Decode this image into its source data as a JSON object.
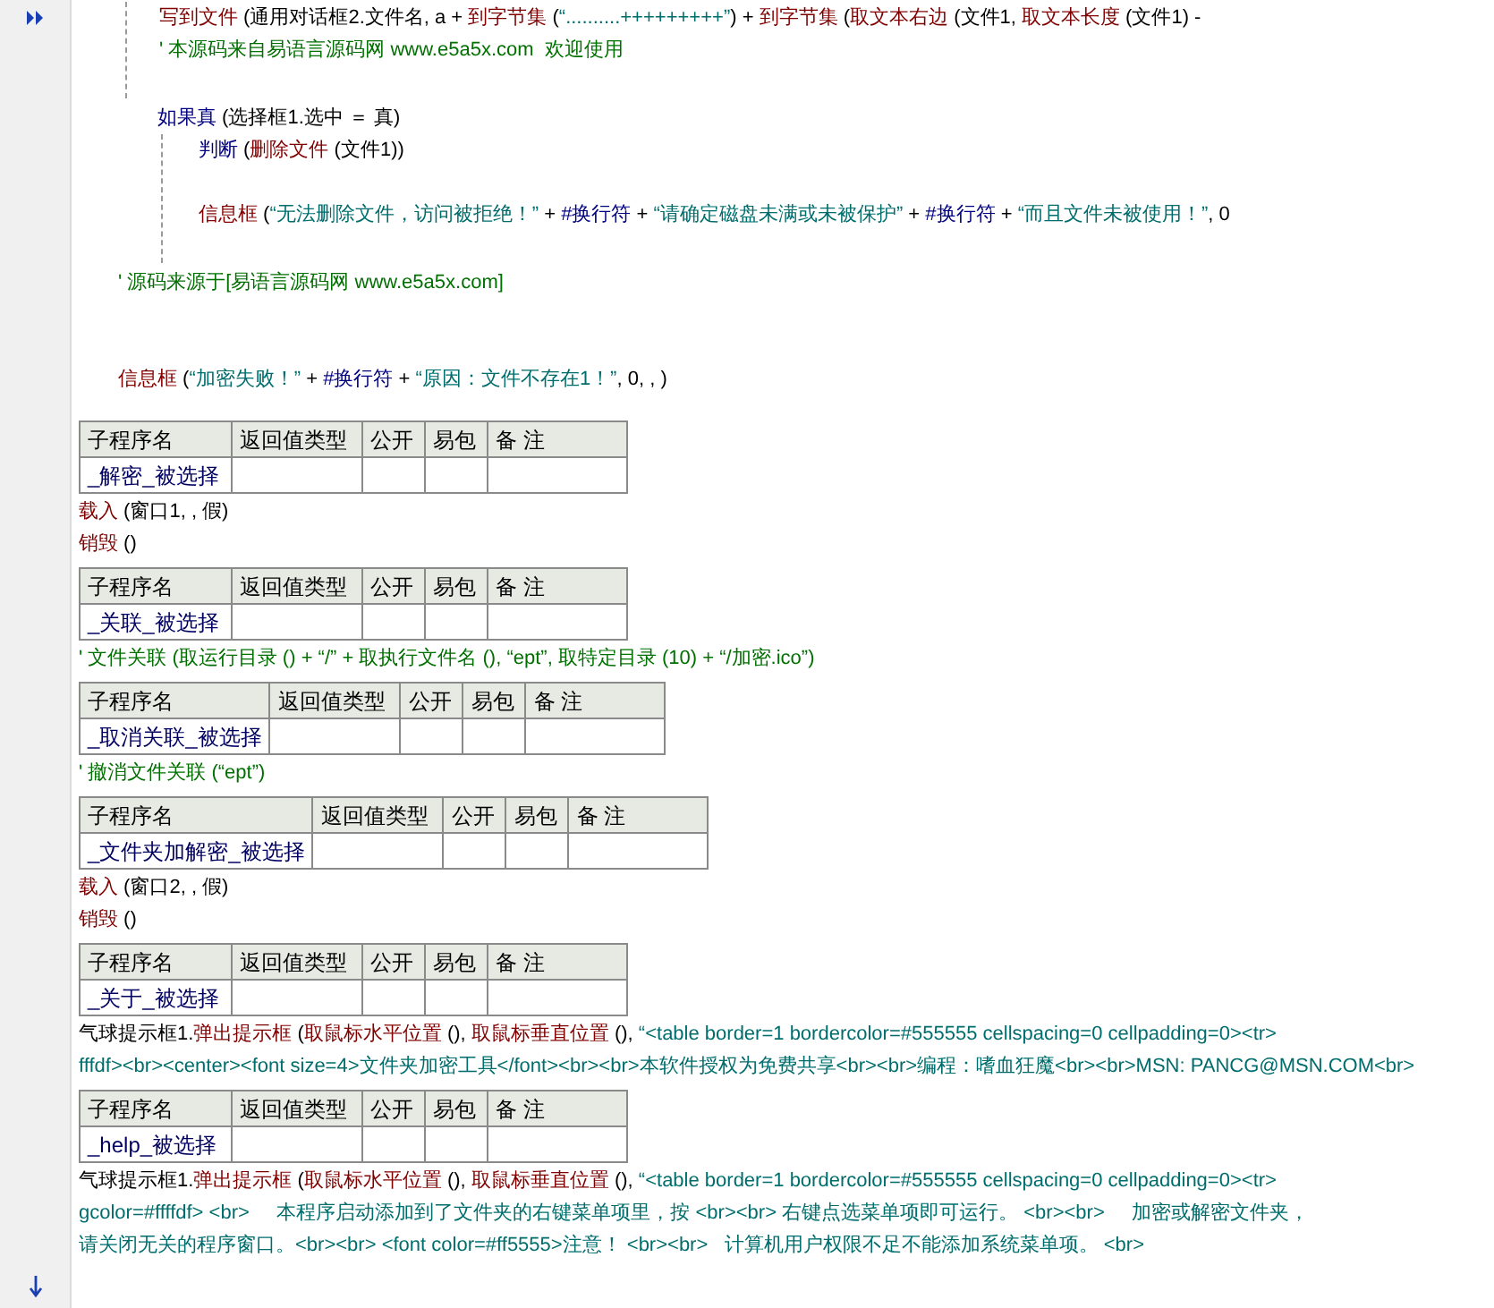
{
  "continued_lines": [
    {
      "segments": [
        {
          "kind": "cmd",
          "text": "写到文件"
        },
        {
          "kind": "plain",
          "text": " (通用对话框2.文件名, a + "
        },
        {
          "kind": "cmd",
          "text": "到字节集"
        },
        {
          "kind": "plain",
          "text": " ("
        },
        {
          "kind": "string",
          "text": "“..........+++++++++”"
        },
        {
          "kind": "plain",
          "text": ") + "
        },
        {
          "kind": "cmd",
          "text": "到字节集"
        },
        {
          "kind": "plain",
          "text": " ("
        },
        {
          "kind": "cmd",
          "text": "取文本右边"
        },
        {
          "kind": "plain",
          "text": " (文件1, "
        },
        {
          "kind": "cmd",
          "text": "取文本长度"
        },
        {
          "kind": "plain",
          "text": " (文件1) -"
        }
      ]
    },
    {
      "segments": [
        {
          "kind": "comment",
          "text": "' 本源码来自易语言源码网 www.e5a5x.com  欢迎使用"
        }
      ]
    }
  ],
  "branch": {
    "header": {
      "segments": [
        {
          "kind": "flow",
          "text": "如果真"
        },
        {
          "kind": "plain",
          "text": " (选择框1.选中 ＝ 真)"
        }
      ]
    },
    "children": [
      {
        "segments": [
          {
            "kind": "flow",
            "text": "判断"
          },
          {
            "kind": "plain",
            "text": " ("
          },
          {
            "kind": "cmd",
            "text": "删除文件"
          },
          {
            "kind": "plain",
            "text": " (文件1))"
          }
        ]
      },
      {
        "segments": [
          {
            "kind": "cmd",
            "text": "信息框"
          },
          {
            "kind": "plain",
            "text": " ("
          },
          {
            "kind": "string",
            "text": "“无法删除文件，访问被拒绝！”"
          },
          {
            "kind": "plain",
            "text": " + "
          },
          {
            "kind": "const",
            "text": "#换行符"
          },
          {
            "kind": "plain",
            "text": " + "
          },
          {
            "kind": "string",
            "text": "“请确定磁盘未满或未被保护”"
          },
          {
            "kind": "plain",
            "text": " + "
          },
          {
            "kind": "const",
            "text": "#换行符"
          },
          {
            "kind": "plain",
            "text": " + "
          },
          {
            "kind": "string",
            "text": "“而且文件未被使用！”"
          },
          {
            "kind": "plain",
            "text": ", 0"
          }
        ]
      }
    ]
  },
  "trailing_lines": [
    {
      "segments": [
        {
          "kind": "comment",
          "text": "' 源码来源于[易语言源码网 www.e5a5x.com]"
        }
      ]
    },
    {
      "segments": [
        {
          "kind": "cmd",
          "text": "信息框"
        },
        {
          "kind": "plain",
          "text": " ("
        },
        {
          "kind": "string",
          "text": "“加密失败！”"
        },
        {
          "kind": "plain",
          "text": " + "
        },
        {
          "kind": "const",
          "text": "#换行符"
        },
        {
          "kind": "plain",
          "text": " + "
        },
        {
          "kind": "string",
          "text": "“原因：文件不存在1！”"
        },
        {
          "kind": "plain",
          "text": ", 0, , )"
        }
      ]
    }
  ],
  "routines": [
    {
      "columns": [
        "子程序名",
        "返回值类型",
        "公开",
        "易包",
        "备 注"
      ],
      "name": "_解密_被选择",
      "body": [
        {
          "segments": [
            {
              "kind": "cmd",
              "text": "载入"
            },
            {
              "kind": "plain",
              "text": " (窗口1, , 假)"
            }
          ]
        },
        {
          "segments": [
            {
              "kind": "cmd",
              "text": "销毁"
            },
            {
              "kind": "plain",
              "text": " ()"
            }
          ]
        }
      ]
    },
    {
      "columns": [
        "子程序名",
        "返回值类型",
        "公开",
        "易包",
        "备 注"
      ],
      "name": "_关联_被选择",
      "body": [
        {
          "segments": [
            {
              "kind": "comment",
              "text": "' 文件关联 (取运行目录 () + “/” + 取执行文件名 (), “ept”, 取特定目录 (10) + “/加密.ico”)"
            }
          ]
        }
      ]
    },
    {
      "columns": [
        "子程序名",
        "返回值类型",
        "公开",
        "易包",
        "备 注"
      ],
      "name": "_取消关联_被选择",
      "body": [
        {
          "segments": [
            {
              "kind": "comment",
              "text": "' 撤消文件关联 (“ept”)"
            }
          ]
        }
      ]
    },
    {
      "columns": [
        "子程序名",
        "返回值类型",
        "公开",
        "易包",
        "备 注"
      ],
      "name": "_文件夹加解密_被选择",
      "body": [
        {
          "segments": [
            {
              "kind": "cmd",
              "text": "载入"
            },
            {
              "kind": "plain",
              "text": " (窗口2, , 假)"
            }
          ]
        },
        {
          "segments": [
            {
              "kind": "cmd",
              "text": "销毁"
            },
            {
              "kind": "plain",
              "text": " ()"
            }
          ]
        }
      ]
    },
    {
      "columns": [
        "子程序名",
        "返回值类型",
        "公开",
        "易包",
        "备 注"
      ],
      "name": "_关于_被选择",
      "body": [
        {
          "segments": [
            {
              "kind": "plain",
              "text": "气球提示框1."
            },
            {
              "kind": "cmd",
              "text": "弹出提示框"
            },
            {
              "kind": "plain",
              "text": " ("
            },
            {
              "kind": "cmd",
              "text": "取鼠标水平位置"
            },
            {
              "kind": "plain",
              "text": " (), "
            },
            {
              "kind": "cmd",
              "text": "取鼠标垂直位置"
            },
            {
              "kind": "plain",
              "text": " (), "
            },
            {
              "kind": "string",
              "text": "“<table border=1 bordercolor=#555555 cellspacing=0 cellpadding=0><tr>"
            }
          ]
        },
        {
          "segments": [
            {
              "kind": "string",
              "text": "fffdf><br><center><font size=4>文件夹加密工具</font><br><br>本软件授权为免费共享<br><br>编程：嗜血狂魔<br><br>MSN: PANCG@MSN.COM<br>"
            }
          ]
        }
      ]
    },
    {
      "columns": [
        "子程序名",
        "返回值类型",
        "公开",
        "易包",
        "备 注"
      ],
      "name": "_help_被选择",
      "body": [
        {
          "segments": [
            {
              "kind": "plain",
              "text": "气球提示框1."
            },
            {
              "kind": "cmd",
              "text": "弹出提示框"
            },
            {
              "kind": "plain",
              "text": " ("
            },
            {
              "kind": "cmd",
              "text": "取鼠标水平位置"
            },
            {
              "kind": "plain",
              "text": " (), "
            },
            {
              "kind": "cmd",
              "text": "取鼠标垂直位置"
            },
            {
              "kind": "plain",
              "text": " (), "
            },
            {
              "kind": "string",
              "text": "“<table border=1 bordercolor=#555555 cellspacing=0 cellpadding=0><tr>"
            }
          ]
        },
        {
          "segments": [
            {
              "kind": "string",
              "text": "gcolor=#ffffdf> <br>     本程序启动添加到了文件夹的右键菜单项里，按 <br><br> 右键点选菜单项即可运行。 <br><br>     加密或解密文件夹，"
            }
          ]
        },
        {
          "segments": [
            {
              "kind": "string",
              "text": "请关闭无关的程序窗口。<br><br> <font color=#ff5555>注意！ <br><br>   计算机用户权限不足不能添加系统菜单项。 <br>"
            }
          ]
        }
      ]
    }
  ]
}
